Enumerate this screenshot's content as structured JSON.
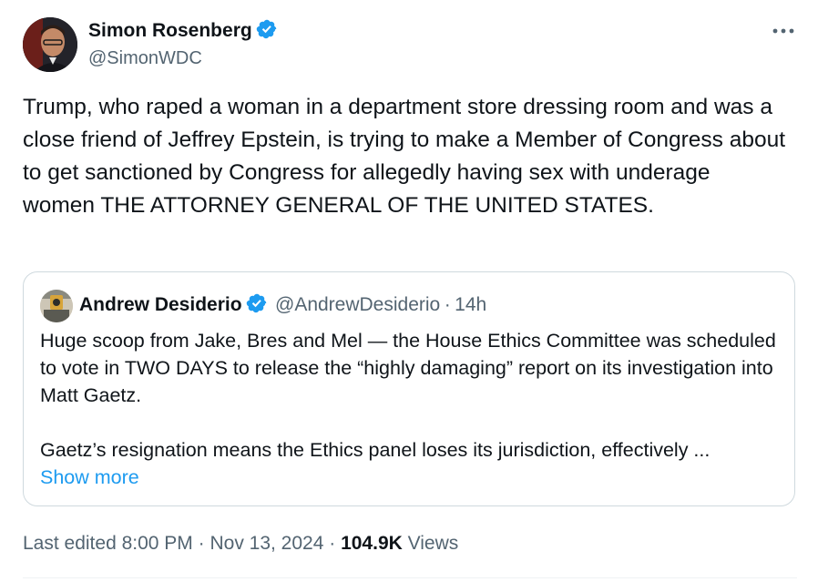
{
  "author": {
    "name": "Simon Rosenberg",
    "handle": "@SimonWDC",
    "verified": true
  },
  "more_icon": "more-horizontal-icon",
  "tweet_text": "Trump, who raped a woman in a department store dressing room and was a close friend of Jeffrey Epstein, is trying to make a Member of Congress about to get sanctioned by Congress for allegedly having sex with underage women THE ATTORNEY GENERAL OF THE UNITED STATES.",
  "quoted": {
    "name": "Andrew Desiderio",
    "handle": "@AndrewDesiderio",
    "separator": "·",
    "time": "14h",
    "verified": true,
    "text_para1": "Huge scoop from Jake, Bres and Mel — the House Ethics Committee was scheduled to vote in TWO DAYS to release the “highly damaging” report on its investigation into Matt Gaetz.",
    "text_para2": "Gaetz’s resignation means the Ethics panel loses its jurisdiction, effectively ...",
    "show_more": "Show more"
  },
  "meta": {
    "edited": "Last edited 8:00 PM",
    "sep1": " · ",
    "date": "Nov 13, 2024",
    "sep2": " · ",
    "views_count": "104.9K",
    "views_label": " Views"
  },
  "colors": {
    "verified_blue": "#1d9bf0",
    "link_blue": "#1d9bf0",
    "secondary_text": "#536471",
    "primary_text": "#0f1419",
    "border": "#cfd9de"
  }
}
